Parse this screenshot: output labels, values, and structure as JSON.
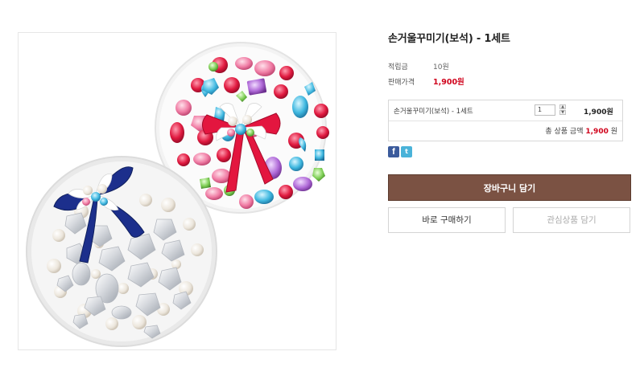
{
  "product": {
    "title": "손거울꾸미기(보석) - 1세트",
    "image_alt": "손거울 꾸미기 보석 완성 예시"
  },
  "info": {
    "points_label": "적립금",
    "points_value": "10원",
    "price_label": "판매가격",
    "price_value": "1,900원"
  },
  "option": {
    "name": "손거울꾸미기(보석) - 1세트",
    "quantity": "1",
    "price": "1,900원"
  },
  "total": {
    "label": "총 상품 금액",
    "amount": "1,900",
    "unit": "원"
  },
  "share": {
    "facebook": "f",
    "twitter": "t"
  },
  "buttons": {
    "cart": "장바구니 담기",
    "buy": "바로 구매하기",
    "wishlist": "관심상품 담기"
  },
  "colors": {
    "accent_brown": "#7b5243",
    "price_red": "#d0021b",
    "facebook_blue": "#3b5b9c",
    "twitter_blue": "#4ab3d9"
  }
}
